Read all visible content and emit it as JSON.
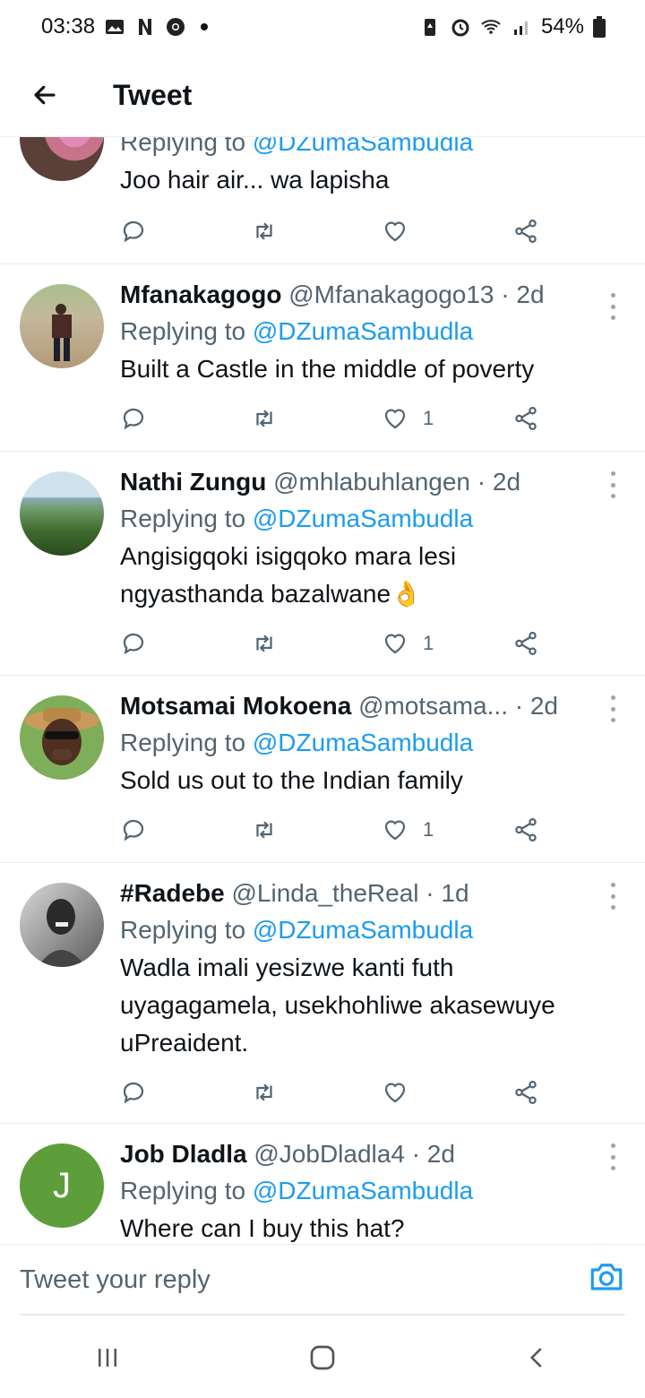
{
  "status_bar": {
    "time": "03:38",
    "battery": "54%",
    "icons_left": [
      "gallery-icon",
      "netflix-n-icon",
      "chrome-icon"
    ],
    "icons_right": [
      "battery-saver-icon",
      "alarm-icon",
      "wifi-icon",
      "signal-icon",
      "battery-icon"
    ]
  },
  "header": {
    "title": "Tweet"
  },
  "tweets": [
    {
      "name": "",
      "handle": "",
      "time": "",
      "replying_to_label": "Replying to",
      "replying_to": "@DZumaSambudla",
      "text": "Joo hair air... wa lapisha",
      "likes": ""
    },
    {
      "name": "Mfanakagogo",
      "handle": "@Mfanakagogo13",
      "time": "· 2d",
      "replying_to_label": "Replying to",
      "replying_to": "@DZumaSambudla",
      "text": "Built a Castle in the middle of poverty",
      "likes": "1"
    },
    {
      "name": "Nathi Zungu",
      "handle": "@mhlabuhlangen",
      "time": "· 2d",
      "replying_to_label": "Replying to",
      "replying_to": "@DZumaSambudla",
      "text": "Angisigqoki isigqoko mara lesi\nngyasthanda bazalwane👌",
      "likes": "1"
    },
    {
      "name": "Motsamai Mokoena",
      "handle": "@motsama...",
      "time": "· 2d",
      "replying_to_label": "Replying to",
      "replying_to": "@DZumaSambudla",
      "text": "Sold us out to the Indian family",
      "likes": "1"
    },
    {
      "name": "#Radebe",
      "handle": "@Linda_theReal",
      "time": "· 1d",
      "replying_to_label": "Replying to",
      "replying_to": "@DZumaSambudla",
      "text": "Wadla imali yesizwe kanti futh\nuyagagamela, usekhohliwe akasewuye\nuPreaident.",
      "likes": ""
    },
    {
      "name": "Job Dladla",
      "handle": "@JobDladla4",
      "time": "· 2d",
      "avatar_letter": "J",
      "replying_to_label": "Replying to",
      "replying_to": "@DZumaSambudla",
      "text": "Where can I buy this hat?",
      "likes": ""
    }
  ],
  "reply_bar": {
    "placeholder": "Tweet your reply"
  },
  "colors": {
    "accent": "#1d9bf0",
    "muted": "#536471",
    "text": "#0f1419",
    "job_avatar": "#5d9e3b"
  }
}
